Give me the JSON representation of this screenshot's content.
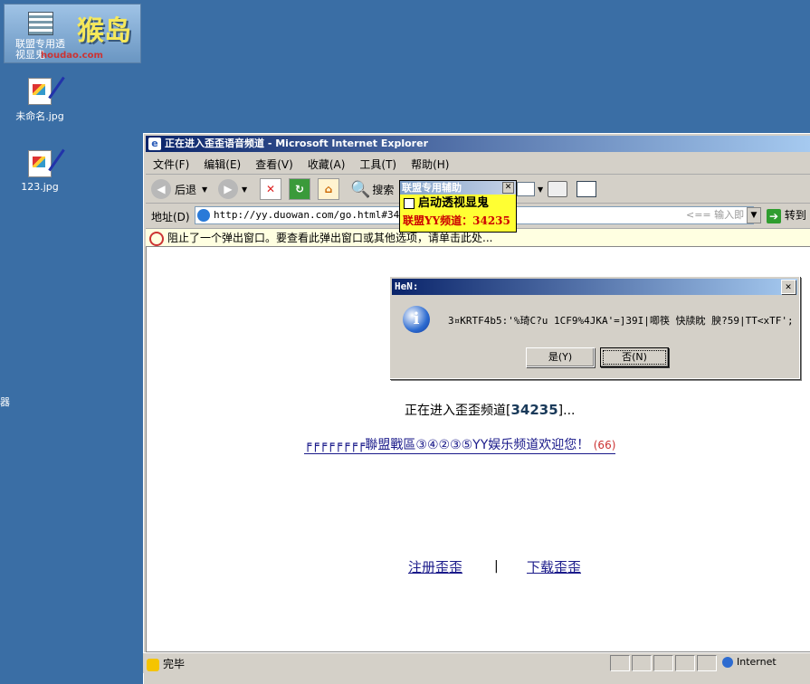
{
  "desktop": {
    "logo": {
      "big_text": "猴岛",
      "line1": "联盟专用透",
      "line2": "视显鬼",
      "url": "houdao.com"
    },
    "icons": [
      {
        "label": "未命名.jpg"
      },
      {
        "label": "123.jpg"
      }
    ],
    "left_edge_char": "器"
  },
  "ie": {
    "title": "正在进入歪歪语音频道 - Microsoft Internet Explorer",
    "menu": [
      "文件(F)",
      "编辑(E)",
      "查看(V)",
      "收藏(A)",
      "工具(T)",
      "帮助(H)"
    ],
    "toolbar": {
      "back": "后退",
      "search": "搜索"
    },
    "address": {
      "label": "地址(D)",
      "url": "http://yy.duowan.com/go.html#34235",
      "search_hint": "<== 输入即可搜索",
      "go": "转到"
    },
    "infobar": "阻止了一个弹出窗口。要查看此弹出窗口或其他选项，请单击此处...",
    "status": {
      "text": "完毕",
      "zone": "Internet"
    }
  },
  "plugin": {
    "title": "联盟专用辅助",
    "checkbox_label": "启动透视显鬼",
    "channel_line": "联盟YY频道：34235"
  },
  "page": {
    "entering_prefix": "正在进入歪歪频道[",
    "channel_id": "34235",
    "entering_suffix": "]...",
    "welcome": "╒╒╒╒╒╒╒╒聯盟戰區③④②③⑤YY娱乐频道欢迎您！",
    "welcome_count": "(66)",
    "register_link": "注册歪歪",
    "separator": "|",
    "download_link": "下载歪歪"
  },
  "dialog": {
    "title": "HeN:",
    "message": "3¤KRTF4b5:'%琦C?u  1CF9%4JKA'=]39I|唧筷  快牍眈  腴?59|TT<xTF';",
    "yes": "是(Y)",
    "no": "否(N)"
  }
}
